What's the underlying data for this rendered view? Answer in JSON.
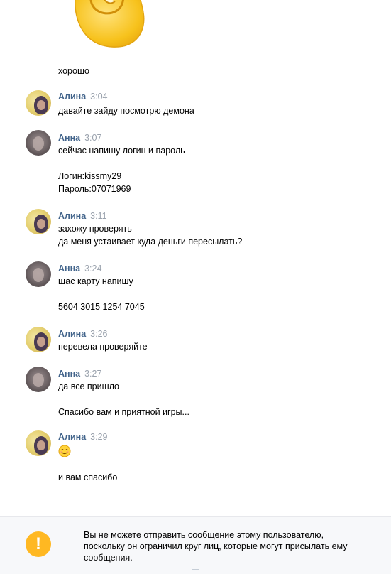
{
  "messages": [
    {
      "text": "хорошо"
    },
    {
      "author": "Алина",
      "time": "3:04",
      "lines": [
        "давайте зайду посмотрю демона"
      ]
    },
    {
      "author": "Анна",
      "time": "3:07",
      "lines": [
        "сейчас напишу логин и пароль",
        "Логин:kissmy29",
        "Пароль:07071969"
      ]
    },
    {
      "author": "Алина",
      "time": "3:11",
      "lines": [
        "захожу проверять",
        "да меня устаивает куда деньги пересылать?"
      ]
    },
    {
      "author": "Анна",
      "time": "3:24",
      "lines": [
        "щас карту напишу",
        "5604 3015 1254 7045"
      ]
    },
    {
      "author": "Алина",
      "time": "3:26",
      "lines": [
        "перевела проверяйте"
      ]
    },
    {
      "author": "Анна",
      "time": "3:27",
      "lines": [
        "да все пришло",
        "Спасибо вам и приятной игры..."
      ]
    },
    {
      "author": "Алина",
      "time": "3:29",
      "emoji": "smile-emoji",
      "lines": [
        "и вам спасибо"
      ]
    }
  ],
  "notice": {
    "icon": "warning-icon",
    "text": "Вы не можете отправить сообщение этому пользователю, поскольку он ограничил круг лиц, которые могут присылать ему сообщения."
  },
  "colors": {
    "author_name": "#42648b",
    "time": "#9aa2ad",
    "warning": "#ffb822",
    "notice_bg": "#f7f8fa"
  }
}
